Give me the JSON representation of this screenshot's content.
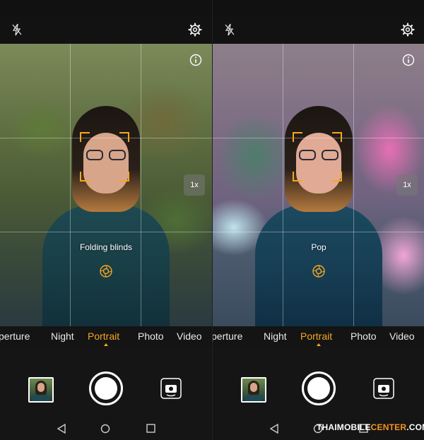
{
  "colors": {
    "accent": "#f5a623",
    "background": "#111111",
    "watermark_accent": "#f7931e"
  },
  "left_screen": {
    "effect_label": "Folding blinds",
    "zoom_label": "1x",
    "selected_effect": "folding-blinds",
    "modes": [
      {
        "label": "perture",
        "active": false
      },
      {
        "label": "Night",
        "active": false
      },
      {
        "label": "Portrait",
        "active": true
      },
      {
        "label": "Photo",
        "active": false
      },
      {
        "label": "Video",
        "active": false
      }
    ]
  },
  "right_screen": {
    "effect_label": "Pop",
    "zoom_label": "1x",
    "selected_effect": "pop",
    "modes": [
      {
        "label": "perture",
        "active": false
      },
      {
        "label": "Night",
        "active": false
      },
      {
        "label": "Portrait",
        "active": true
      },
      {
        "label": "Photo",
        "active": false
      },
      {
        "label": "Video",
        "active": false
      }
    ]
  },
  "icons": [
    "flash-off-icon",
    "gear-icon",
    "info-icon",
    "focus-box",
    "aperture-icon",
    "shutter-button",
    "switch-camera-icon",
    "back-icon",
    "home-icon",
    "recents-icon"
  ],
  "watermark": {
    "part1": "THAIMOBILE",
    "part2": "CENTER",
    "part3": ".COM"
  }
}
